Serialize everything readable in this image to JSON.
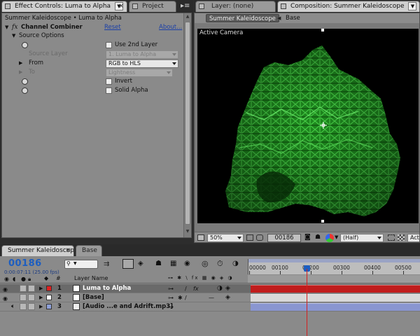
{
  "tabs_top": {
    "effect_controls": "Effect Controls: Luma to Alpha",
    "project": "Project",
    "layer": "Layer: (none)",
    "composition": "Composition: Summer Kaleidoscope"
  },
  "effect_controls": {
    "header": "Summer Kaleidoscope • Luma to Alpha",
    "fx_label": "fx",
    "effect_name": "Channel Combiner",
    "reset": "Reset",
    "about": "About...",
    "group_name": "Source Options",
    "use_2nd_layer": "Use 2nd Layer",
    "source_layer_label": "Source Layer",
    "source_layer_value": "1. Luma to Alpha",
    "from_label": "From",
    "from_value": "RGB to HLS",
    "to_label": "To",
    "to_value": "Lightness",
    "invert": "Invert",
    "solid_alpha": "Solid Alpha"
  },
  "composition": {
    "breadcrumb_comp": "Summer Kaleidoscope",
    "breadcrumb_layer": "Base",
    "overlay_label": "Active Camera",
    "zoom": "50%",
    "timecode": "00186",
    "resolution": "(Half)",
    "view": "Acti"
  },
  "timeline": {
    "tab_active": "Summer Kaleidoscope",
    "tab_inactive": "Base",
    "current_frame": "00186",
    "timecode_detail": "0:00:07:11 (25.00 fps)",
    "search_placeholder": "",
    "column_layer_name": "Layer Name",
    "column_hash": "#",
    "ruler_ticks": [
      "00000",
      "00100",
      "00200",
      "00300",
      "00400",
      "00500"
    ],
    "layers": [
      {
        "num": "1",
        "name": "Luma to Alpha",
        "label_color": "#e02020"
      },
      {
        "num": "2",
        "name": "[Base]",
        "label_color": "#ffffff"
      },
      {
        "num": "3",
        "name": "[Audio ...e and Adrift.mp3]",
        "label_color": "#8ea0d8"
      }
    ]
  },
  "colors": {
    "accent_blue": "#1d5ec0",
    "playhead": "#d42020",
    "bar_layer1": "#c01c1c",
    "bar_layer2": "#d8d8d8",
    "bar_layer3": "#8a96d0"
  }
}
